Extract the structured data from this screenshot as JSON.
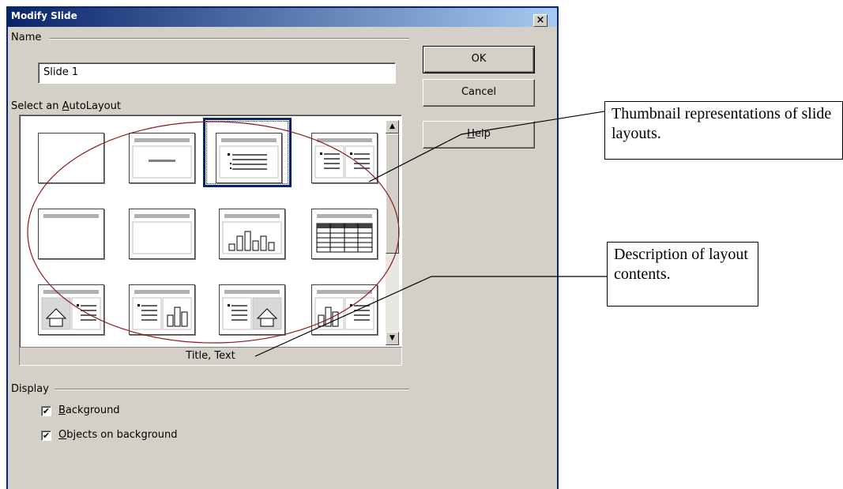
{
  "dialog": {
    "title": "Modify Slide",
    "close_label": "×"
  },
  "name_group": {
    "label": "Name",
    "value": "Slide 1"
  },
  "autolayout": {
    "label_pre": "Select an ",
    "label_mnemonic": "A",
    "label_post": "utoLayout",
    "selected_description": "Title, Text",
    "layouts": [
      {
        "icon": "blank-slide-icon"
      },
      {
        "icon": "title-slide-icon"
      },
      {
        "icon": "title-text-icon"
      },
      {
        "icon": "title-two-text-columns-icon"
      },
      {
        "icon": "title-only-icon"
      },
      {
        "icon": "centered-text-icon"
      },
      {
        "icon": "title-chart-icon"
      },
      {
        "icon": "title-spreadsheet-icon"
      },
      {
        "icon": "title-clipart-text-icon"
      },
      {
        "icon": "title-text-chart-icon"
      },
      {
        "icon": "title-text-clipart-icon"
      },
      {
        "icon": "title-chart-text-icon"
      }
    ]
  },
  "buttons": {
    "ok": "OK",
    "cancel": "Cancel",
    "help_mnemonic": "H",
    "help_rest": "elp"
  },
  "display_group": {
    "label": "Display",
    "background_mnemonic": "B",
    "background_rest": "ackground",
    "background_checked": true,
    "objects_mnemonic": "O",
    "objects_rest": "bjects on background",
    "objects_checked": true
  },
  "annotations": {
    "thumbnail_callout": "Thumbnail representations of slide layouts.",
    "description_callout": "Description of layout contents."
  },
  "colors": {
    "dialog_face": "#d4d0c8",
    "titlebar_start": "#0a246a",
    "titlebar_end": "#a6caf0",
    "ellipse": "#8b1a1a"
  }
}
